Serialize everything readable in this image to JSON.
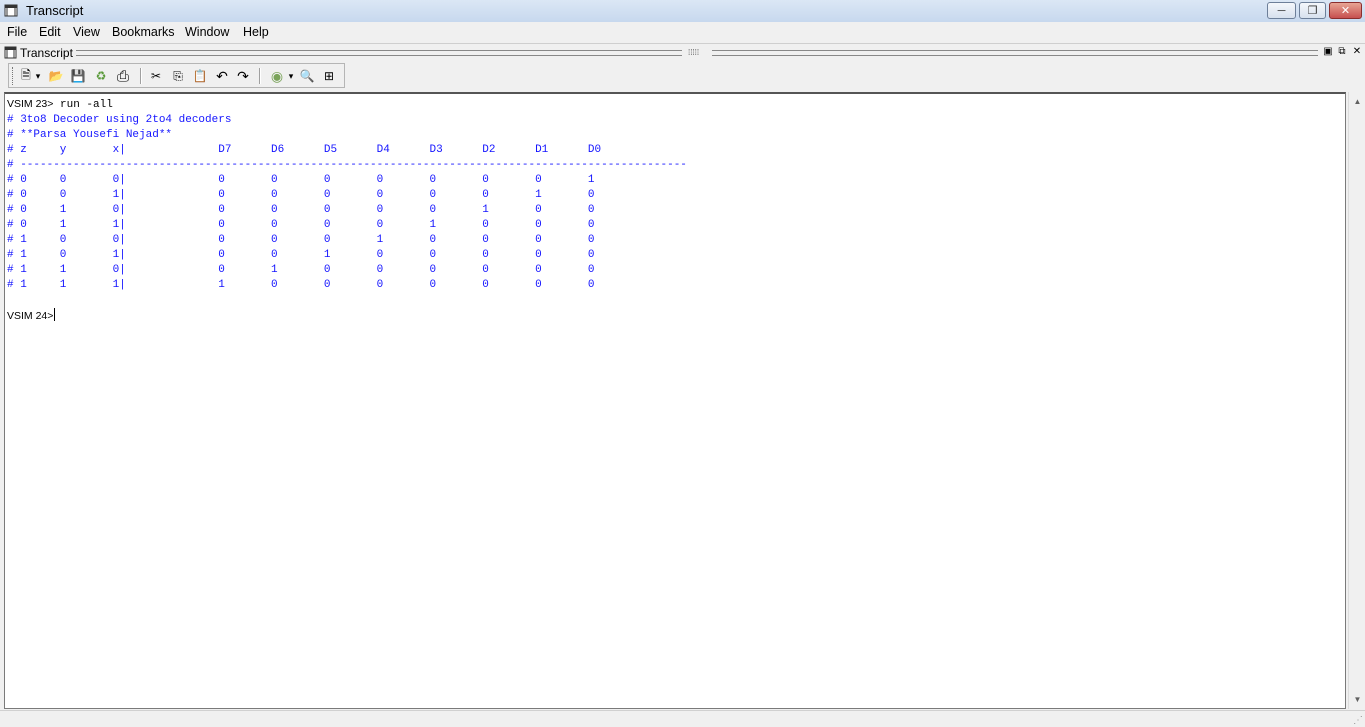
{
  "window": {
    "title": "Transcript",
    "controls": {
      "minimize": "─",
      "maximize": "❐",
      "close": "✕"
    }
  },
  "menu": [
    "File",
    "Edit",
    "View",
    "Bookmarks",
    "Window",
    "Help"
  ],
  "pane": {
    "title": "Transcript",
    "controls": {
      "dock": "▣",
      "undock": "⧉",
      "close": "✕"
    }
  },
  "toolbar": {
    "buttons": [
      {
        "icon": "new-file-icon",
        "glyph": "🗎"
      },
      {
        "icon": "dropdown-arrow-icon",
        "glyph": "▾"
      },
      {
        "icon": "open-folder-icon",
        "glyph": "📂"
      },
      {
        "icon": "save-icon",
        "glyph": "💾"
      },
      {
        "icon": "reload-icon",
        "glyph": "♻"
      },
      {
        "icon": "print-icon",
        "glyph": "⎙"
      },
      {
        "icon": "cut-icon",
        "glyph": "✂"
      },
      {
        "icon": "copy-icon",
        "glyph": "⎘"
      },
      {
        "icon": "paste-icon",
        "glyph": "📋"
      },
      {
        "icon": "undo-icon",
        "glyph": "↶"
      },
      {
        "icon": "redo-icon",
        "glyph": "↷"
      },
      {
        "icon": "compile-icon",
        "glyph": "◉"
      },
      {
        "icon": "dropdown-arrow-icon",
        "glyph": "▾"
      },
      {
        "icon": "find-icon",
        "glyph": "🔍"
      },
      {
        "icon": "format-icon",
        "glyph": "⊞"
      }
    ]
  },
  "transcript": {
    "prompt1": "VSIM 23>",
    "command1": " run -all",
    "output_lines": [
      "# 3to8 Decoder using 2to4 decoders",
      "# **Parsa Yousefi Nejad**",
      "# z     y       x|              D7      D6      D5      D4      D3      D2      D1      D0",
      "# -----------------------------------------------------------------------------------------------------",
      "# 0     0       0|              0       0       0       0       0       0       0       1",
      "# 0     0       1|              0       0       0       0       0       0       1       0",
      "# 0     1       0|              0       0       0       0       0       1       0       0",
      "# 0     1       1|              0       0       0       0       1       0       0       0",
      "# 1     0       0|              0       0       0       1       0       0       0       0",
      "# 1     0       1|              0       0       1       0       0       0       0       0",
      "# 1     1       0|              0       1       0       0       0       0       0       0",
      "# 1     1       1|              1       0       0       0       0       0       0       0"
    ],
    "prompt2": "VSIM 24>"
  },
  "scrollbar": {
    "up": "▲",
    "down": "▼"
  },
  "statusbar": {
    "grip": "⋰"
  }
}
